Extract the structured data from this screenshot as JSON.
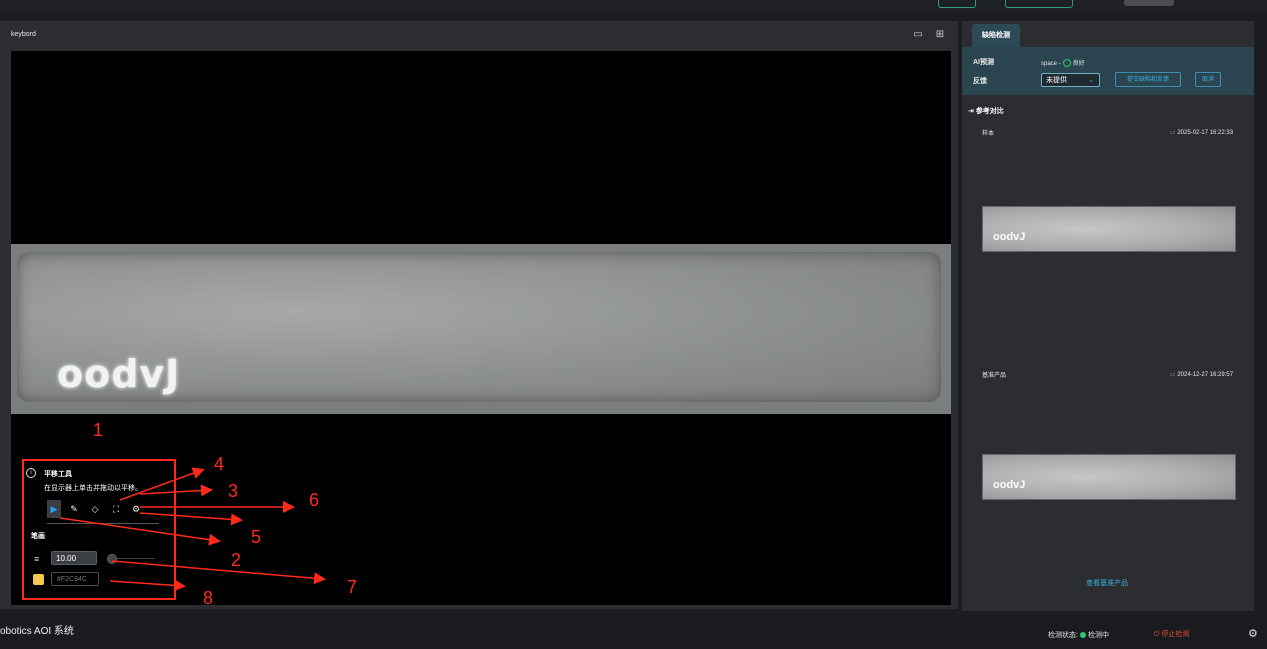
{
  "viewer": {
    "title": "keybord",
    "key_logo": "oodvJ"
  },
  "tool_panel": {
    "title": "平移工具",
    "description": "在显示器上单击并拖动以平移。",
    "pen_label": "笔画",
    "stroke_width": "10.00",
    "color_value": "#F2C94C",
    "swatch_color": "#F2C94C",
    "tools": [
      "pan-icon",
      "pencil-icon",
      "eraser-icon",
      "fit-icon",
      "settings-icon"
    ]
  },
  "annotations": {
    "n1": "1",
    "n2": "2",
    "n3": "3",
    "n4": "4",
    "n5": "5",
    "n6": "6",
    "n7": "7",
    "n8": "8"
  },
  "side": {
    "tab": "缺陷检测",
    "ai_label": "AI预测",
    "ai_value": "space -",
    "ai_status": "良好",
    "feedback_label": "反馈",
    "feedback_select": "未提供",
    "submit_button": "提交缺陷和反馈",
    "cancel_button": "取消",
    "reference_title": "参考对比",
    "sample_label": "样本",
    "sample_time": "2025-02-17 16:22:33",
    "sample_logo": "oodvJ",
    "standard_label": "基准产品",
    "standard_time": "2024-12-27 16:29:57",
    "standard_logo": "oodvJ",
    "view_link": "查看基准产品"
  },
  "footer": {
    "title": "obotics AOI 系统",
    "status_label": "检测状态:",
    "status_value": "检测中",
    "stop_button": "停止检测"
  }
}
